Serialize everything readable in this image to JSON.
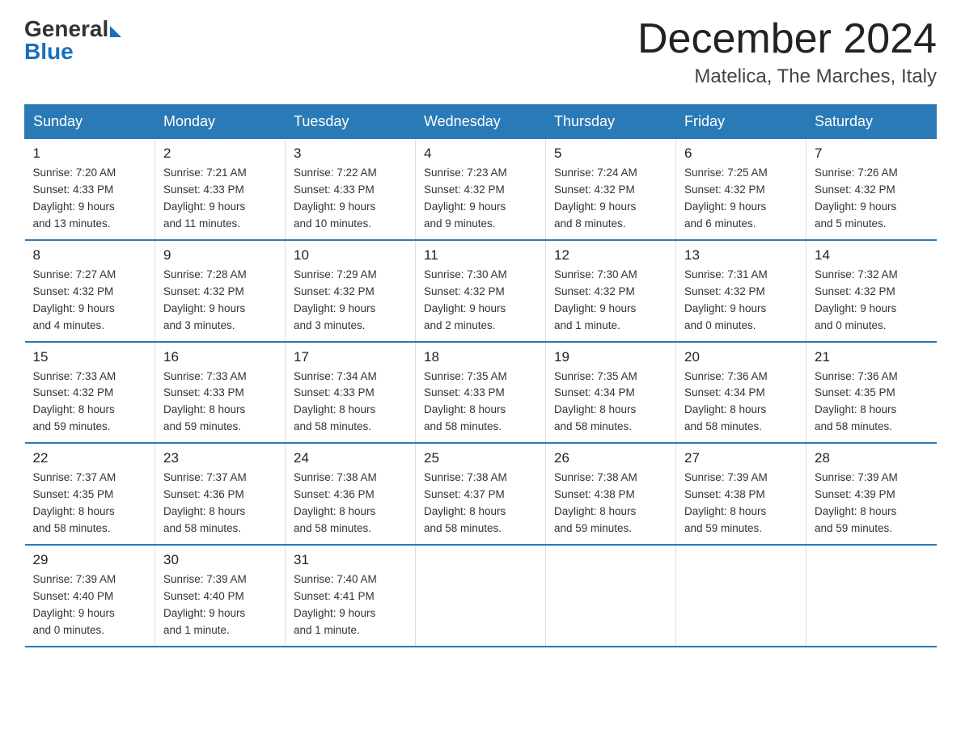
{
  "header": {
    "logo_general": "General",
    "logo_blue": "Blue",
    "month_title": "December 2024",
    "location": "Matelica, The Marches, Italy"
  },
  "days_of_week": [
    "Sunday",
    "Monday",
    "Tuesday",
    "Wednesday",
    "Thursday",
    "Friday",
    "Saturday"
  ],
  "weeks": [
    [
      {
        "day": "1",
        "sunrise": "7:20 AM",
        "sunset": "4:33 PM",
        "daylight": "9 hours and 13 minutes."
      },
      {
        "day": "2",
        "sunrise": "7:21 AM",
        "sunset": "4:33 PM",
        "daylight": "9 hours and 11 minutes."
      },
      {
        "day": "3",
        "sunrise": "7:22 AM",
        "sunset": "4:33 PM",
        "daylight": "9 hours and 10 minutes."
      },
      {
        "day": "4",
        "sunrise": "7:23 AM",
        "sunset": "4:32 PM",
        "daylight": "9 hours and 9 minutes."
      },
      {
        "day": "5",
        "sunrise": "7:24 AM",
        "sunset": "4:32 PM",
        "daylight": "9 hours and 8 minutes."
      },
      {
        "day": "6",
        "sunrise": "7:25 AM",
        "sunset": "4:32 PM",
        "daylight": "9 hours and 6 minutes."
      },
      {
        "day": "7",
        "sunrise": "7:26 AM",
        "sunset": "4:32 PM",
        "daylight": "9 hours and 5 minutes."
      }
    ],
    [
      {
        "day": "8",
        "sunrise": "7:27 AM",
        "sunset": "4:32 PM",
        "daylight": "9 hours and 4 minutes."
      },
      {
        "day": "9",
        "sunrise": "7:28 AM",
        "sunset": "4:32 PM",
        "daylight": "9 hours and 3 minutes."
      },
      {
        "day": "10",
        "sunrise": "7:29 AM",
        "sunset": "4:32 PM",
        "daylight": "9 hours and 3 minutes."
      },
      {
        "day": "11",
        "sunrise": "7:30 AM",
        "sunset": "4:32 PM",
        "daylight": "9 hours and 2 minutes."
      },
      {
        "day": "12",
        "sunrise": "7:30 AM",
        "sunset": "4:32 PM",
        "daylight": "9 hours and 1 minute."
      },
      {
        "day": "13",
        "sunrise": "7:31 AM",
        "sunset": "4:32 PM",
        "daylight": "9 hours and 0 minutes."
      },
      {
        "day": "14",
        "sunrise": "7:32 AM",
        "sunset": "4:32 PM",
        "daylight": "9 hours and 0 minutes."
      }
    ],
    [
      {
        "day": "15",
        "sunrise": "7:33 AM",
        "sunset": "4:32 PM",
        "daylight": "8 hours and 59 minutes."
      },
      {
        "day": "16",
        "sunrise": "7:33 AM",
        "sunset": "4:33 PM",
        "daylight": "8 hours and 59 minutes."
      },
      {
        "day": "17",
        "sunrise": "7:34 AM",
        "sunset": "4:33 PM",
        "daylight": "8 hours and 58 minutes."
      },
      {
        "day": "18",
        "sunrise": "7:35 AM",
        "sunset": "4:33 PM",
        "daylight": "8 hours and 58 minutes."
      },
      {
        "day": "19",
        "sunrise": "7:35 AM",
        "sunset": "4:34 PM",
        "daylight": "8 hours and 58 minutes."
      },
      {
        "day": "20",
        "sunrise": "7:36 AM",
        "sunset": "4:34 PM",
        "daylight": "8 hours and 58 minutes."
      },
      {
        "day": "21",
        "sunrise": "7:36 AM",
        "sunset": "4:35 PM",
        "daylight": "8 hours and 58 minutes."
      }
    ],
    [
      {
        "day": "22",
        "sunrise": "7:37 AM",
        "sunset": "4:35 PM",
        "daylight": "8 hours and 58 minutes."
      },
      {
        "day": "23",
        "sunrise": "7:37 AM",
        "sunset": "4:36 PM",
        "daylight": "8 hours and 58 minutes."
      },
      {
        "day": "24",
        "sunrise": "7:38 AM",
        "sunset": "4:36 PM",
        "daylight": "8 hours and 58 minutes."
      },
      {
        "day": "25",
        "sunrise": "7:38 AM",
        "sunset": "4:37 PM",
        "daylight": "8 hours and 58 minutes."
      },
      {
        "day": "26",
        "sunrise": "7:38 AM",
        "sunset": "4:38 PM",
        "daylight": "8 hours and 59 minutes."
      },
      {
        "day": "27",
        "sunrise": "7:39 AM",
        "sunset": "4:38 PM",
        "daylight": "8 hours and 59 minutes."
      },
      {
        "day": "28",
        "sunrise": "7:39 AM",
        "sunset": "4:39 PM",
        "daylight": "8 hours and 59 minutes."
      }
    ],
    [
      {
        "day": "29",
        "sunrise": "7:39 AM",
        "sunset": "4:40 PM",
        "daylight": "9 hours and 0 minutes."
      },
      {
        "day": "30",
        "sunrise": "7:39 AM",
        "sunset": "4:40 PM",
        "daylight": "9 hours and 1 minute."
      },
      {
        "day": "31",
        "sunrise": "7:40 AM",
        "sunset": "4:41 PM",
        "daylight": "9 hours and 1 minute."
      },
      null,
      null,
      null,
      null
    ]
  ],
  "labels": {
    "sunrise_prefix": "Sunrise: ",
    "sunset_prefix": "Sunset: ",
    "daylight_prefix": "Daylight: "
  }
}
